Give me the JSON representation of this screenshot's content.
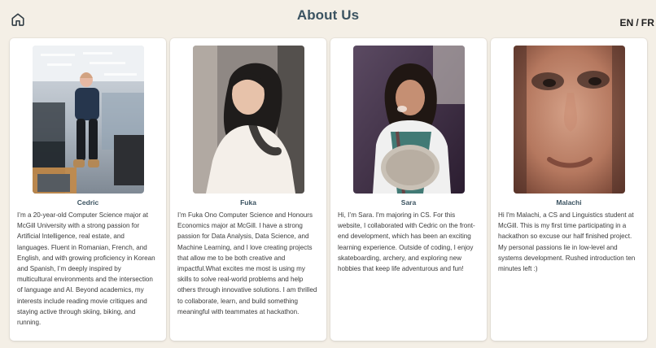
{
  "page": {
    "title": "About Us"
  },
  "nav": {
    "home_icon": "home-icon"
  },
  "language": {
    "options": [
      "EN",
      "FR"
    ],
    "separator": "/",
    "selected": "EN"
  },
  "team": [
    {
      "name": "Cedric",
      "bio": "I’m a 20-year-old Computer Science major at McGill University with a strong passion for Artificial Intelligence, real estate, and languages. Fluent in Romanian, French, and English, and with growing proficiency in Korean and Spanish, I’m deeply inspired by multicultural environments and the intersection of language and AI. Beyond academics, my interests include reading movie critiques and staying active through skiing, biking, and running."
    },
    {
      "name": "Fuka",
      "bio": "I’m Fuka Ono Computer Science and Honours Economics major at McGill. I have a strong passion for Data Analysis, Data Science, and Machine Learning, and I love creating projects that allow me to be both creative and impactful.What excites me most is using my skills to solve real-world problems and help others through innovative solutions. I am thrilled to collaborate, learn, and build something meaningful with teammates at hackathon."
    },
    {
      "name": "Sara",
      "bio": "Hi, I’m Sara. I'm majoring in CS. For this website, I collaborated with Cedric on the front-end development, which has been an exciting learning experience. Outside of coding, I enjoy skateboarding, archery, and exploring new hobbies that keep life adventurous and fun!"
    },
    {
      "name": "Malachi",
      "bio": "Hi I'm Malachi, a CS and Linguistics student at McGill. This is my first time participating in a hackathon so excuse our half finished project. My personal passions lie in low-level and systems development. Rushed introduction ten minutes left :)"
    }
  ]
}
